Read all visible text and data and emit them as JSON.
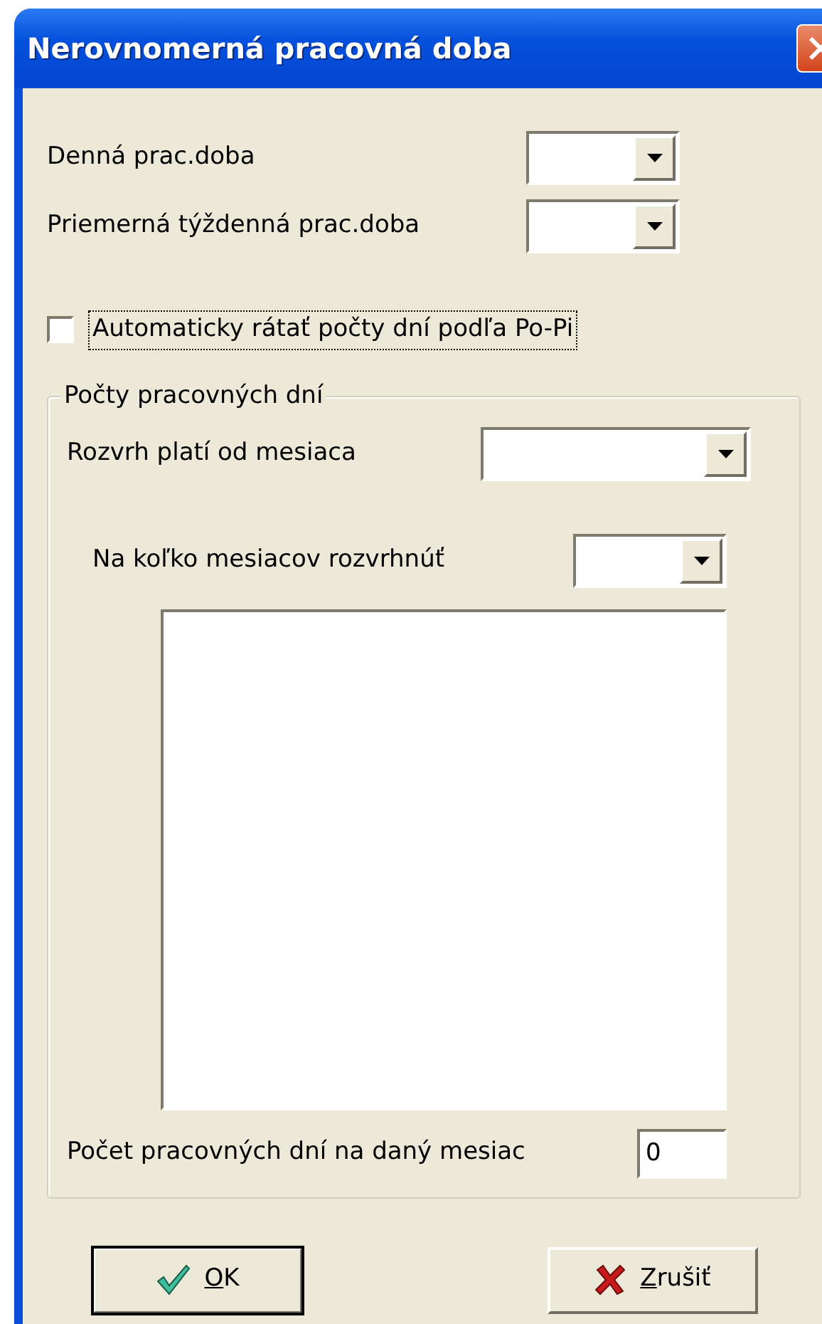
{
  "window": {
    "title": "Nerovnomerná pracovná doba"
  },
  "fields": [
    {
      "label": "Denná prac.doba"
    },
    {
      "label": "Priemerná týždenná prac.doba"
    }
  ],
  "auto_count": {
    "label": "Automaticky rátať počty dní podľa Po-Pi",
    "checked": false,
    "focused": true
  },
  "group": {
    "title": "Počty pracovných dní",
    "schedule_from": {
      "label": "Rozvrh platí od mesiaca"
    },
    "spread_over": {
      "label": "Na koľko mesiacov rozvrhnúť"
    },
    "days_in_month": {
      "label": "Počet pracovných dní na daný mesiac",
      "value": "0"
    }
  },
  "buttons": [
    {
      "label": "OK",
      "kind": "ok"
    },
    {
      "label": "Zrušiť",
      "kind": "cancel"
    }
  ]
}
